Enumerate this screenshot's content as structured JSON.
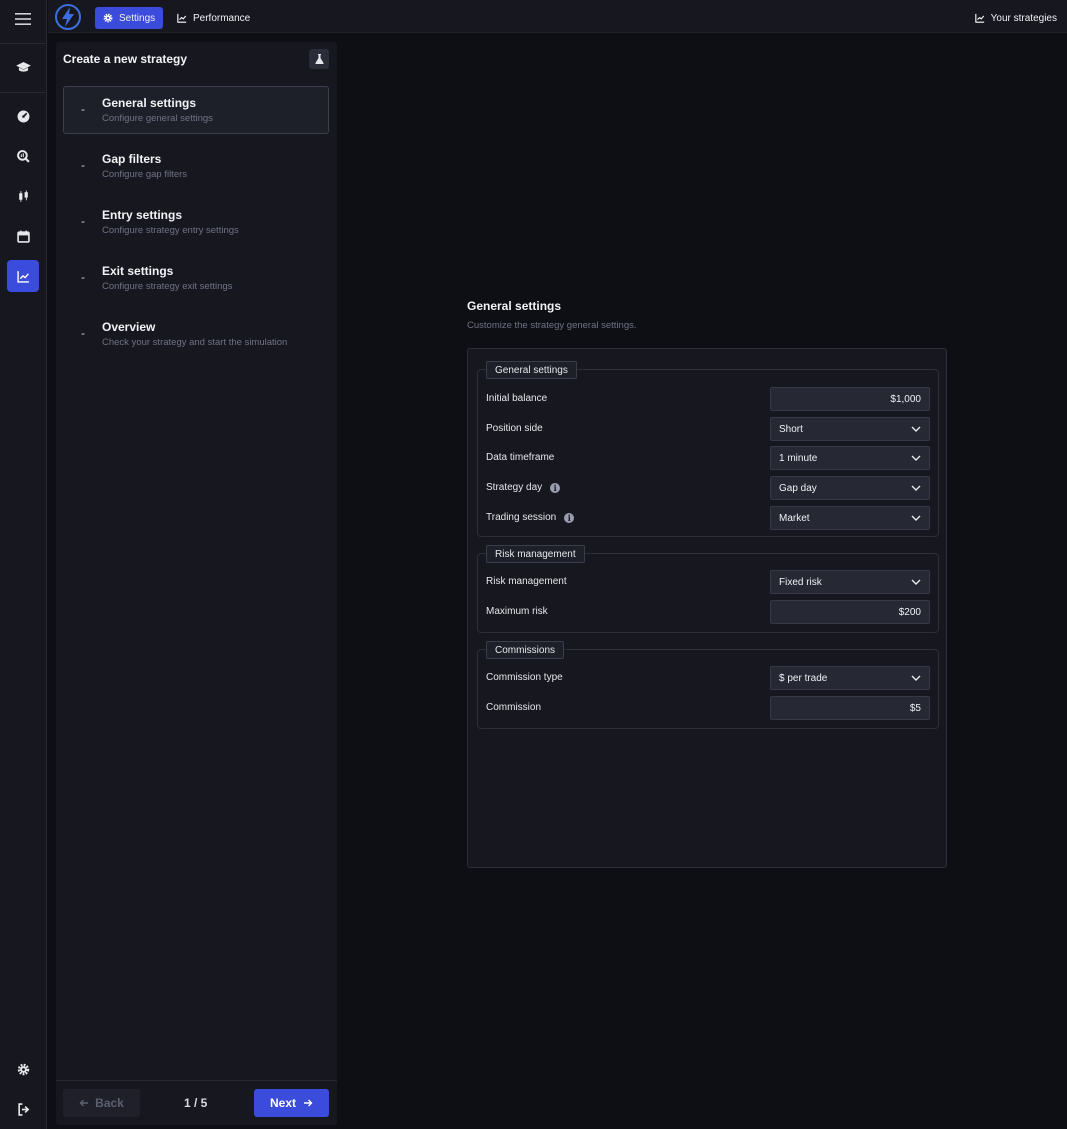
{
  "topbar": {
    "tabs": [
      {
        "label": "Settings",
        "icon": "gear-icon",
        "active": true
      },
      {
        "label": "Performance",
        "icon": "chart-line-icon",
        "active": false
      }
    ],
    "right_link": "Your strategies"
  },
  "sidebar_rail": {
    "items": [
      "menu-icon",
      "graduation-cap-icon",
      "dashboard-icon",
      "search-chart-icon",
      "candlestick-icon",
      "calendar-icon",
      "chart-line-icon",
      "gear-icon",
      "logout-icon"
    ],
    "active": "chart-line-icon"
  },
  "wizard": {
    "title": "Create a new strategy",
    "steps": [
      {
        "dash": "-",
        "title": "General settings",
        "subtitle": "Configure general settings"
      },
      {
        "dash": "-",
        "title": "Gap filters",
        "subtitle": "Configure gap filters"
      },
      {
        "dash": "-",
        "title": "Entry settings",
        "subtitle": "Configure strategy entry settings"
      },
      {
        "dash": "-",
        "title": "Exit settings",
        "subtitle": "Configure strategy exit settings"
      },
      {
        "dash": "-",
        "title": "Overview",
        "subtitle": "Check your strategy and start the simulation"
      }
    ],
    "back_label": "Back",
    "page_indicator": "1 / 5",
    "next_label": "Next"
  },
  "main": {
    "title": "General settings",
    "subtitle": "Customize the strategy general settings.",
    "groups": [
      {
        "legend": "General settings",
        "rows": [
          {
            "label": "Initial balance",
            "value": "$1,000",
            "type": "input"
          },
          {
            "label": "Position side",
            "value": "Short",
            "type": "select"
          },
          {
            "label": "Data timeframe",
            "value": "1 minute",
            "type": "select"
          },
          {
            "label": "Strategy day",
            "value": "Gap day",
            "type": "select",
            "info": "i"
          },
          {
            "label": "Trading session",
            "value": "Market",
            "type": "select",
            "info": "i"
          }
        ]
      },
      {
        "legend": "Risk management",
        "rows": [
          {
            "label": "Risk management",
            "value": "Fixed risk",
            "type": "select"
          },
          {
            "label": "Maximum risk",
            "value": "$200",
            "type": "input"
          }
        ]
      },
      {
        "legend": "Commissions",
        "rows": [
          {
            "label": "Commission type",
            "value": "$ per trade",
            "type": "select"
          },
          {
            "label": "Commission",
            "value": "$5",
            "type": "input"
          }
        ]
      }
    ]
  },
  "colors": {
    "accent": "#3b4bdb",
    "background": "#0e0f14",
    "panel": "#17181f"
  }
}
